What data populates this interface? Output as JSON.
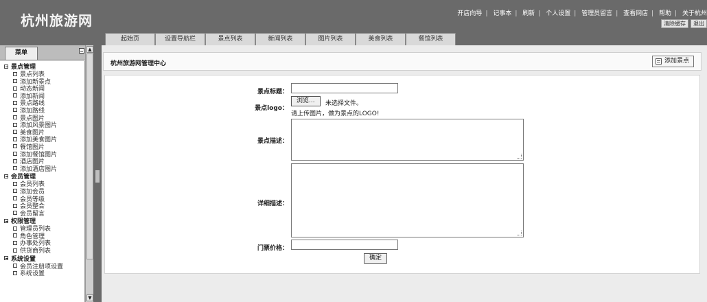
{
  "app": {
    "logo_text": "杭州旅游网"
  },
  "toplinks": [
    "开店向导",
    "记事本",
    "刷新",
    "个人设置",
    "管理员留言",
    "查看网店",
    "帮助",
    "关于杭州"
  ],
  "topbtns": [
    "清除缓存",
    "退出"
  ],
  "navtabs": [
    "起始页",
    "设置导航栏",
    "景点列表",
    "新闻列表",
    "图片列表",
    "美食列表",
    "餐馆列表"
  ],
  "sidebar": {
    "tab_label": "菜单",
    "groups": [
      {
        "title": "景点管理",
        "items": [
          "景点列表",
          "添加新景点",
          "动态新闻",
          "添加新闻",
          "景点路线",
          "添加路线",
          "景点图片",
          "添加风景图片",
          "美食图片",
          "添加美食图片",
          "餐馆图片",
          "添加餐馆图片",
          "酒店图片",
          "添加酒店图片"
        ]
      },
      {
        "title": "会员管理",
        "items": [
          "会员列表",
          "添加会员",
          "会员等级",
          "会员整合",
          "会员留言"
        ]
      },
      {
        "title": "权限管理",
        "items": [
          "管理员列表",
          "角色管理",
          "办事处列表",
          "供货商列表"
        ]
      },
      {
        "title": "系统设置",
        "items": [
          "会员注册项设置",
          "系统设置"
        ]
      }
    ]
  },
  "main": {
    "title": "杭州旅游网管理中心",
    "add_button": "添加景点",
    "form": {
      "title_label": "景点标题：",
      "logo_label": "景点logo：",
      "browse_button": "浏览...",
      "no_file": "未选择文件。",
      "logo_hint": "请上传图片，做为景点的LOGO!",
      "desc_label": "景点描述：",
      "detail_label": "详细描述：",
      "price_label": "门票价格：",
      "submit_button": "确定",
      "title_value": "",
      "price_value": ""
    }
  }
}
